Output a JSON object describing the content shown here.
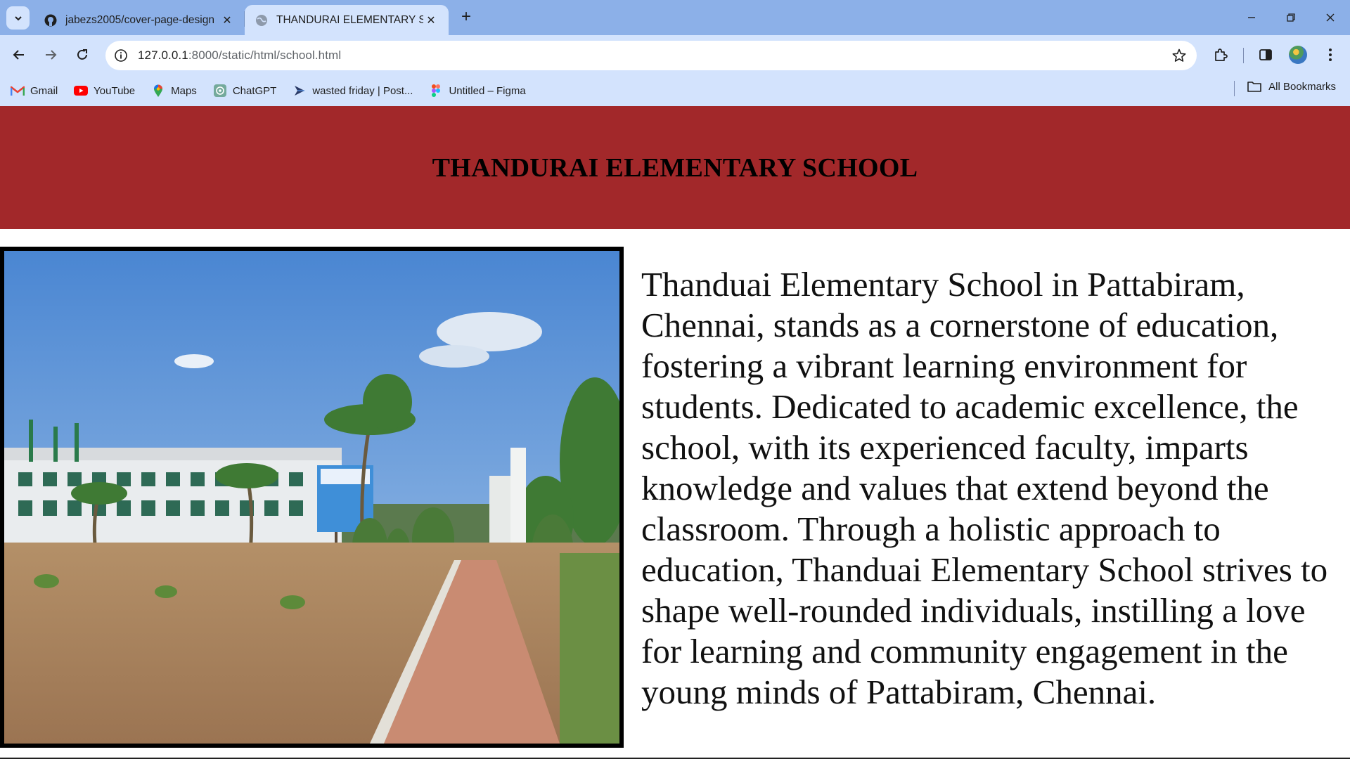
{
  "browser": {
    "tabs": [
      {
        "title": "jabezs2005/cover-page-design",
        "icon": "github-icon"
      },
      {
        "title": "THANDURAI ELEMENTARY SCHOOL",
        "icon": "globe-icon"
      }
    ],
    "url_host": "127.0.0.1",
    "url_rest": ":8000/static/html/school.html",
    "bookmarks": [
      {
        "label": "Gmail",
        "icon": "gmail-icon"
      },
      {
        "label": "YouTube",
        "icon": "youtube-icon"
      },
      {
        "label": "Maps",
        "icon": "maps-icon"
      },
      {
        "label": "ChatGPT",
        "icon": "chatgpt-icon"
      },
      {
        "label": "wasted friday | Post...",
        "icon": "postman-icon"
      },
      {
        "label": "Untitled – Figma",
        "icon": "figma-icon"
      }
    ],
    "all_bookmarks_label": "All Bookmarks"
  },
  "page": {
    "heading": "THANDURAI ELEMENTARY SCHOOL",
    "description": "Thanduai Elementary School in Pattabiram, Chennai, stands as a cornerstone of education, fostering a vibrant learning environment for students. Dedicated to academic excellence, the school, with its experienced faculty, imparts knowledge and values that extend beyond the classroom. Through a holistic approach to education, Thanduai Elementary School strives to shape well-rounded individuals, instilling a love for learning and community engagement in the young minds of Pattabiram, Chennai."
  },
  "colors": {
    "banner": "#a2282a",
    "chrome_tabstrip": "#8cb0e8",
    "chrome_toolbar": "#d3e3fd"
  }
}
